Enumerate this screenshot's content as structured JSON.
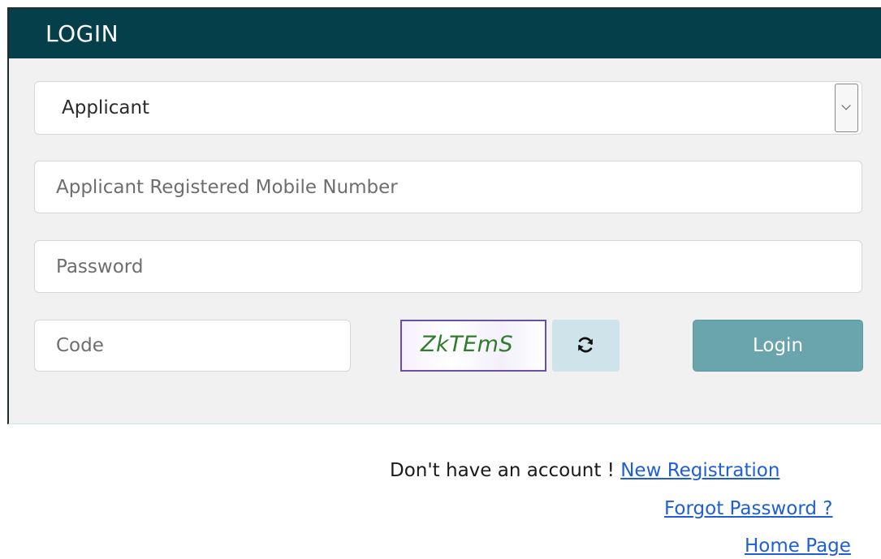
{
  "header": {
    "title": "LOGIN"
  },
  "form": {
    "user_type": {
      "selected": "Applicant",
      "options": [
        "Applicant"
      ]
    },
    "mobile": {
      "placeholder": "Applicant Registered Mobile Number",
      "value": ""
    },
    "password": {
      "placeholder": "Password",
      "value": ""
    },
    "code": {
      "placeholder": "Code",
      "value": ""
    },
    "captcha": {
      "text": "ZkTEmS"
    },
    "refresh": {
      "icon": "refresh-icon"
    },
    "login_label": "Login"
  },
  "footer": {
    "no_account_text": "Don't have an account ! ",
    "new_registration_link": "New Registration",
    "forgot_password_link": "Forgot Password ?",
    "home_page_link": "Home Page"
  },
  "colors": {
    "header_bg": "#043f4a",
    "panel_bg": "#f1f1f1",
    "login_button": "#6aa5ad",
    "refresh_button": "#cfe3ea",
    "link": "#1f5fd6",
    "captcha_border": "#6b4ea5",
    "captcha_text": "#2e7d2a"
  }
}
